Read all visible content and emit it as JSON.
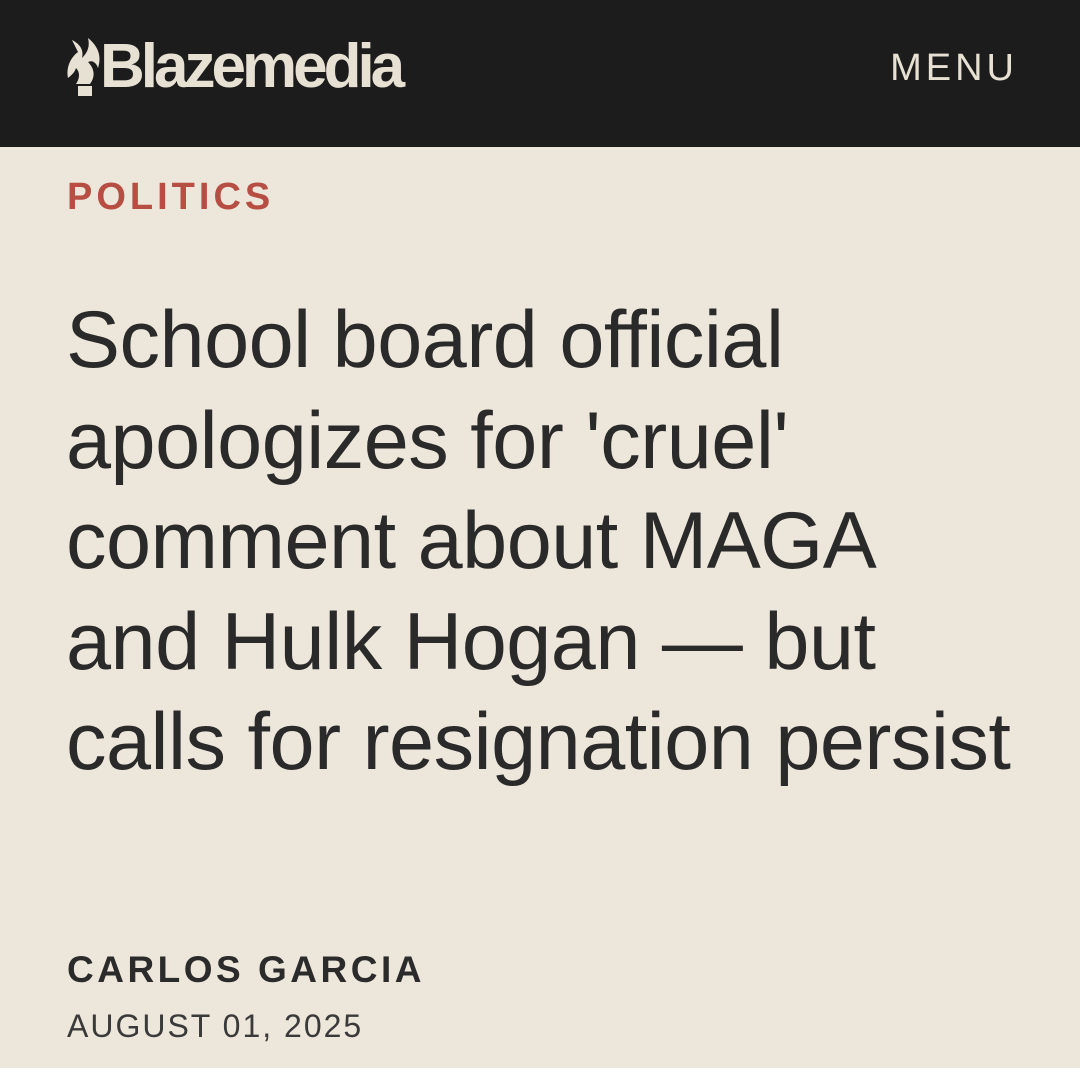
{
  "header": {
    "logo_text": "Blazemedia",
    "menu_label": "MENU"
  },
  "article": {
    "category": "POLITICS",
    "headline": "School board official apologizes for 'cruel' comment about MAGA and Hulk Hogan — but calls for resignation persist",
    "author": "CARLOS GARCIA",
    "date": "AUGUST 01, 2025"
  },
  "colors": {
    "header_bg": "#1c1c1c",
    "page_bg": "#ede7db",
    "logo": "#e7e1d3",
    "category": "#b74e44",
    "text": "#2a2a2a"
  },
  "icons": {
    "logo_mark": "flame-icon"
  }
}
